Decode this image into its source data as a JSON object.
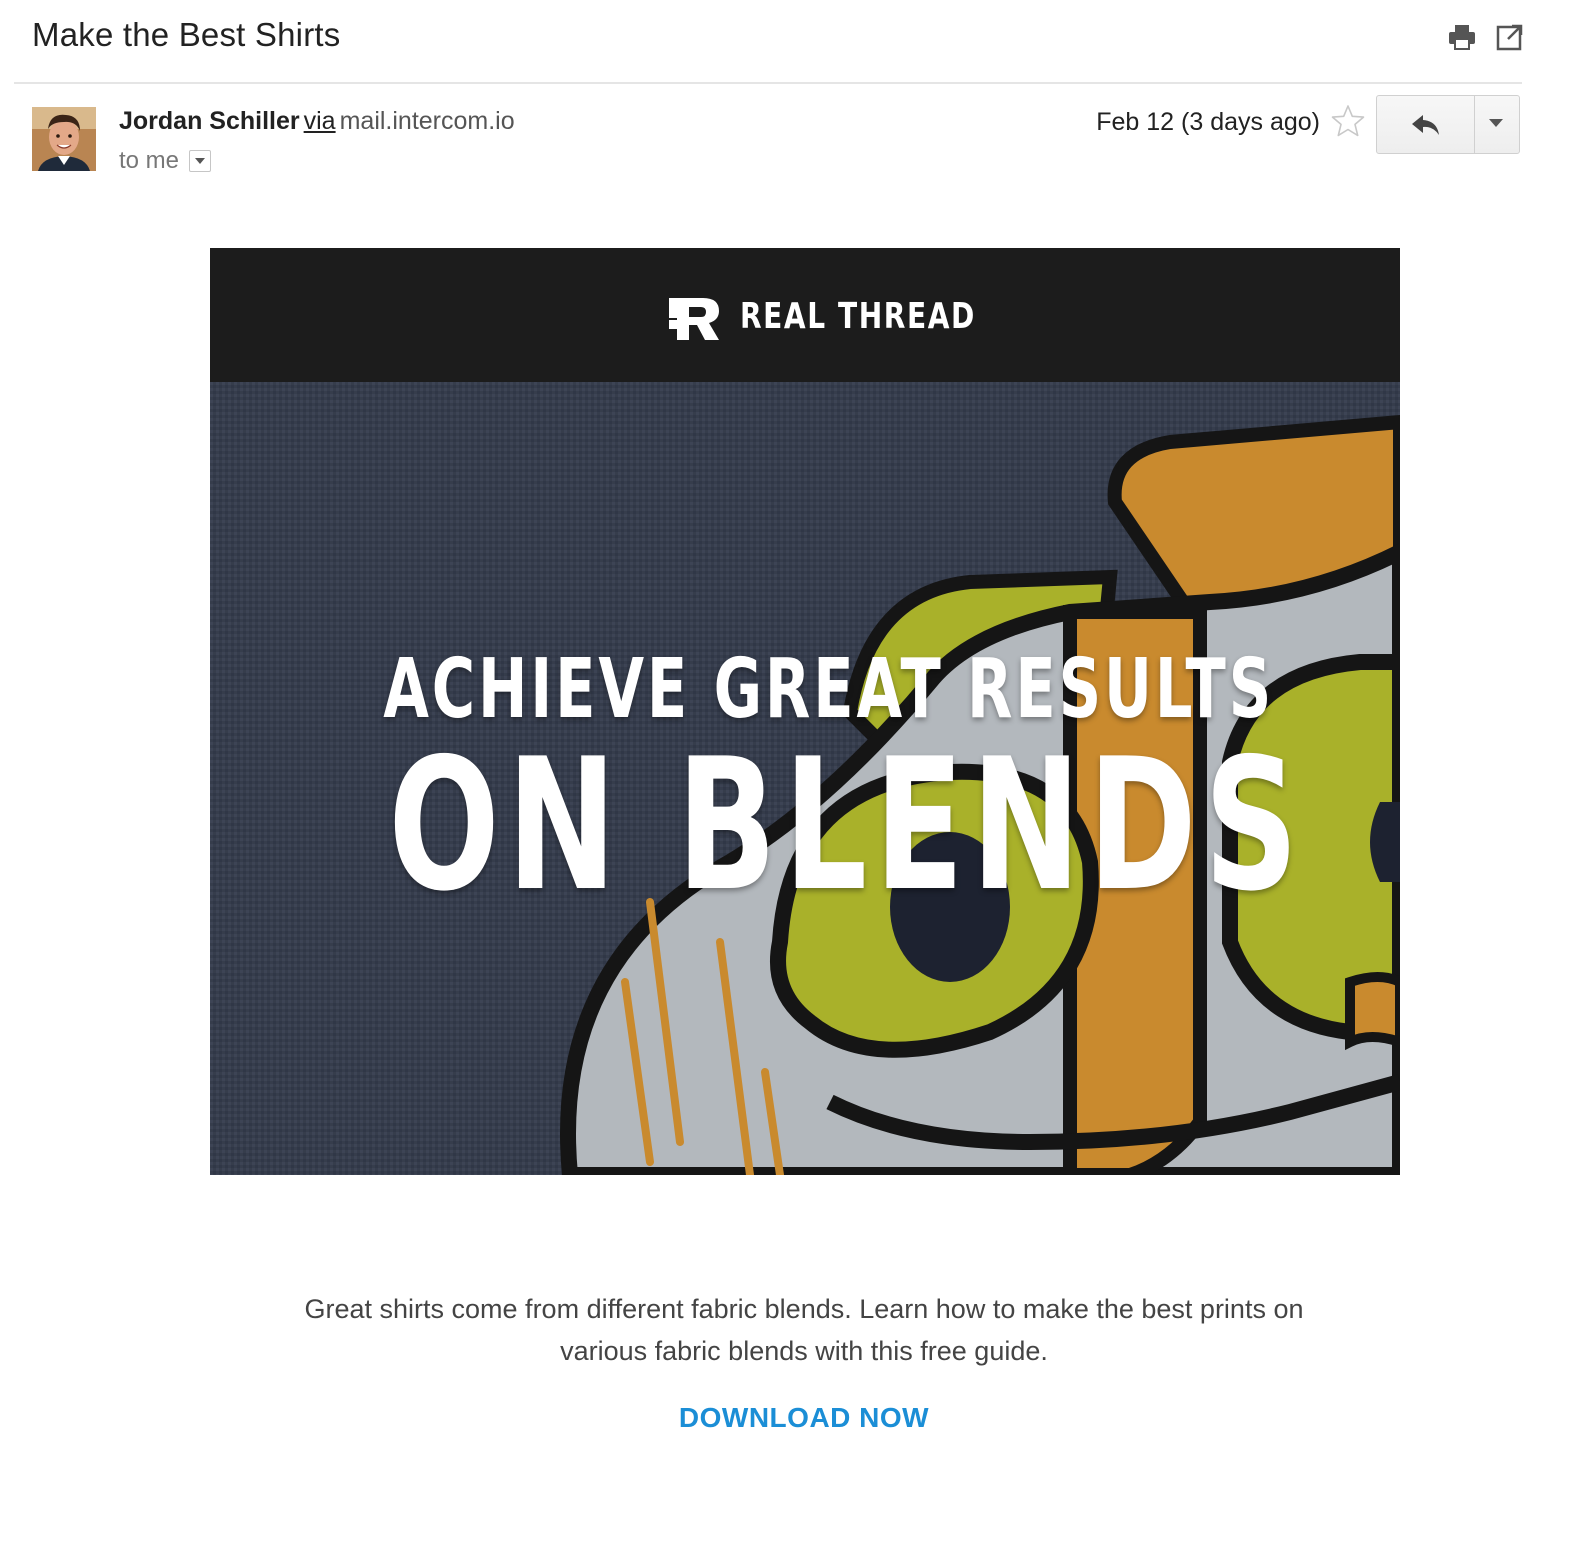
{
  "email": {
    "subject": "Make the Best Shirts",
    "sender_name": "Jordan Schiller",
    "via_label": "via",
    "sender_domain": "mail.intercom.io",
    "to_line": "to me",
    "date": "Feb 12 (3 days ago)"
  },
  "toolbar_icons": [
    "print-icon",
    "open-in-new-window-icon"
  ],
  "action_icons": [
    "star-icon",
    "reply-icon",
    "chevron-down-icon"
  ],
  "content": {
    "brand_name": "REAL THREAD",
    "hero_line1": "ACHIEVE GREAT RESULTS",
    "hero_line2": "ON BLENDS",
    "body_text": "Great shirts come from different fabric blends. Learn how to make the best prints on various fabric blends with this free guide.",
    "cta_label": "DOWNLOAD NOW"
  },
  "colors": {
    "brand_bar": "#1c1c1c",
    "shirt": "#363d4c",
    "print_grey": "#b3b8bd",
    "print_yellow": "#a9b12a",
    "print_orange": "#c98a2e",
    "link": "#1b8ed6"
  }
}
